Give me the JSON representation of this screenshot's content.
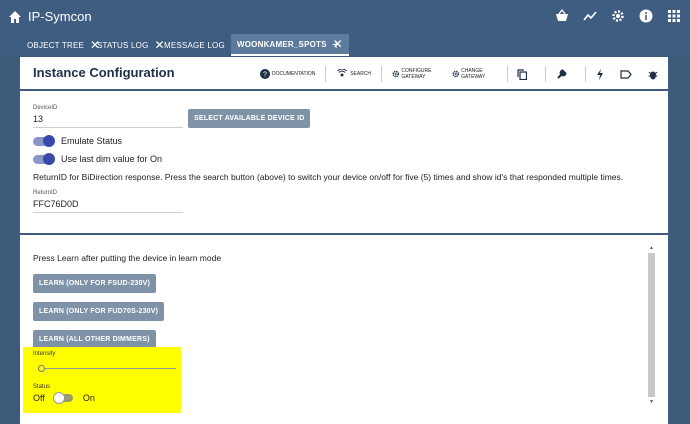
{
  "app": {
    "title": "IP-Symcon"
  },
  "tabs": [
    {
      "label": "OBJECT TREE"
    },
    {
      "label": "STATUS LOG"
    },
    {
      "label": "MESSAGE LOG"
    },
    {
      "label": "WOONKAMER_SPOTS"
    }
  ],
  "header": {
    "title": "Instance Configuration",
    "actions": {
      "documentation": "DOCUMENTATION",
      "search": "SEARCH",
      "configure_gateway": "CONFIGURE GATEWAY",
      "change_gateway": "CHANGE GATEWAY"
    }
  },
  "form": {
    "device_id_label": "DeviceID",
    "device_id_value": "13",
    "select_device_button": "SELECT AVAILABLE DEVICE ID",
    "emulate_status_label": "Emulate Status",
    "last_dim_label": "Use last dim value for On",
    "return_id_info": "ReturnID for BiDirection response. Press the search button (above) to switch your device on/off for five (5) times and show id's that responded multiple times.",
    "return_id_label": "ReturnID",
    "return_id_value": "FFC76D0D"
  },
  "learn": {
    "instruction": "Press Learn after putting the device in learn mode",
    "buttons": [
      "LEARN (ONLY FOR FSUD-230V)",
      "LEARN (ONLY FOR FUD70S-230V)",
      "LEARN (ALL OTHER DIMMERS)"
    ],
    "intensity_label": "Intensity",
    "intensity_value": 0,
    "status_label": "Status",
    "status_off": "Off",
    "status_on": "On"
  },
  "colors": {
    "topbar": "#3f5d80",
    "highlight": "#ffff00",
    "button": "#7f93a8",
    "switch_on": "#3949ab"
  }
}
